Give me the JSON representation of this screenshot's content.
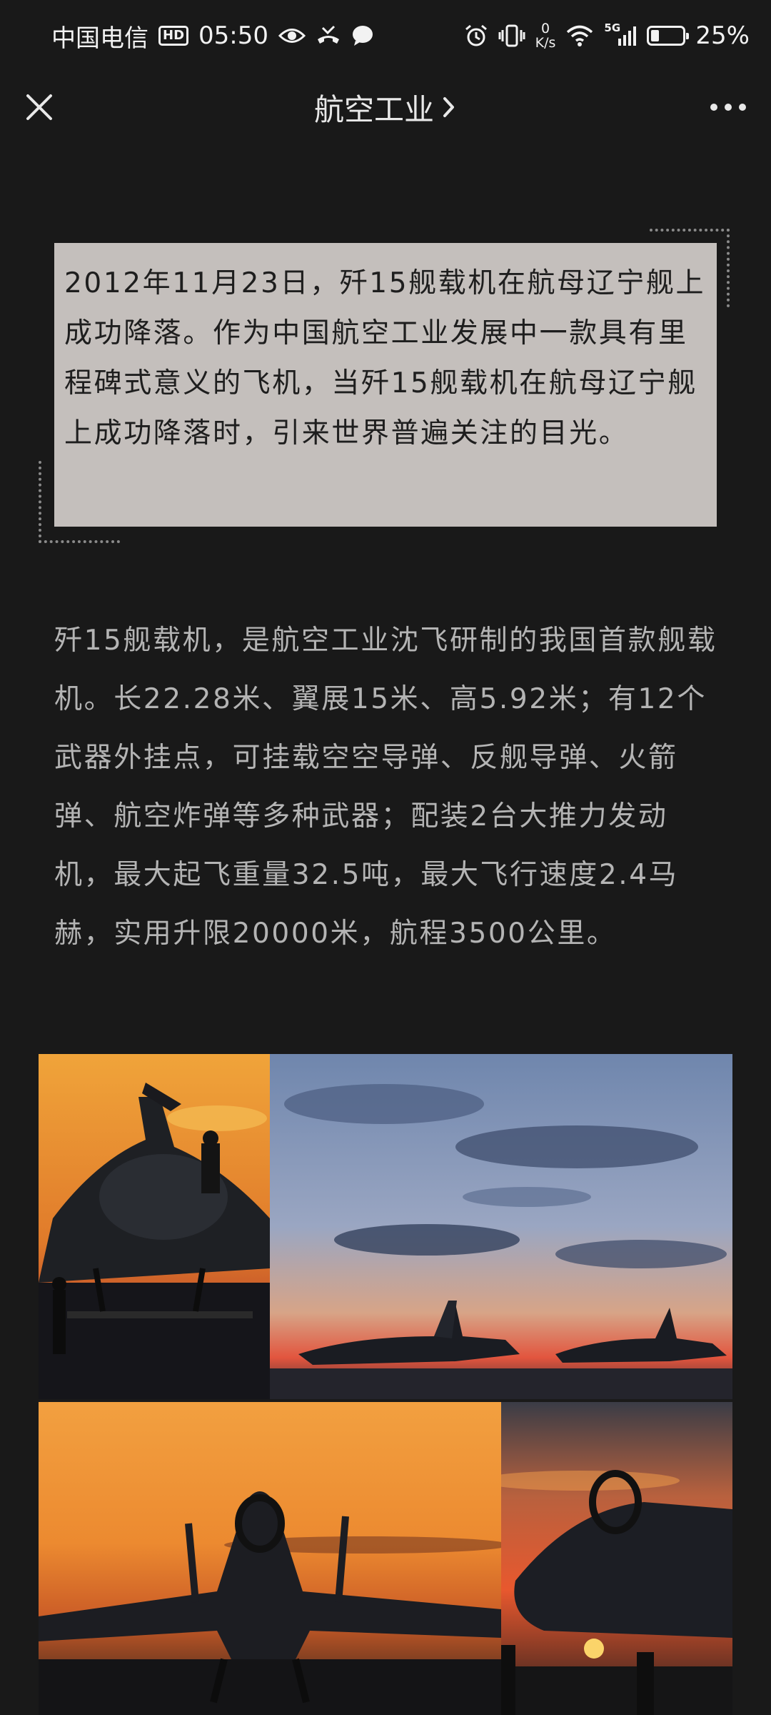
{
  "status_bar": {
    "carrier": "中国电信",
    "hd_badge": "HD",
    "time": "05:50",
    "net_speed_value": "0",
    "net_speed_unit": "K/s",
    "signal_label": "5G",
    "battery_percent": "25%",
    "battery_level": 0.25
  },
  "nav": {
    "title": "航空工业"
  },
  "article": {
    "quote": "2012年11月23日，歼15舰载机在航母辽宁舰上成功降落。作为中国航空工业发展中一款具有里程碑式意义的飞机，当歼15舰载机在航母辽宁舰上成功降落时，引来世界普遍关注的目光。",
    "body": "歼15舰载机，是航空工业沈飞研制的我国首款舰载机。长22.28米、翼展15米、高5.92米；有12个武器外挂点，可挂载空空导弹、反舰导弹、火箭弹、航空炸弹等多种武器；配装2台大推力发动机，最大起飞重量32.5吨，最大飞行速度2.4马赫，实用升限20000米，航程3500公里。"
  },
  "colors": {
    "background": "#191919",
    "quote_bg": "#c4bfbc",
    "body_text": "#b4b4b4",
    "sunset_orange": "#e8892e"
  }
}
